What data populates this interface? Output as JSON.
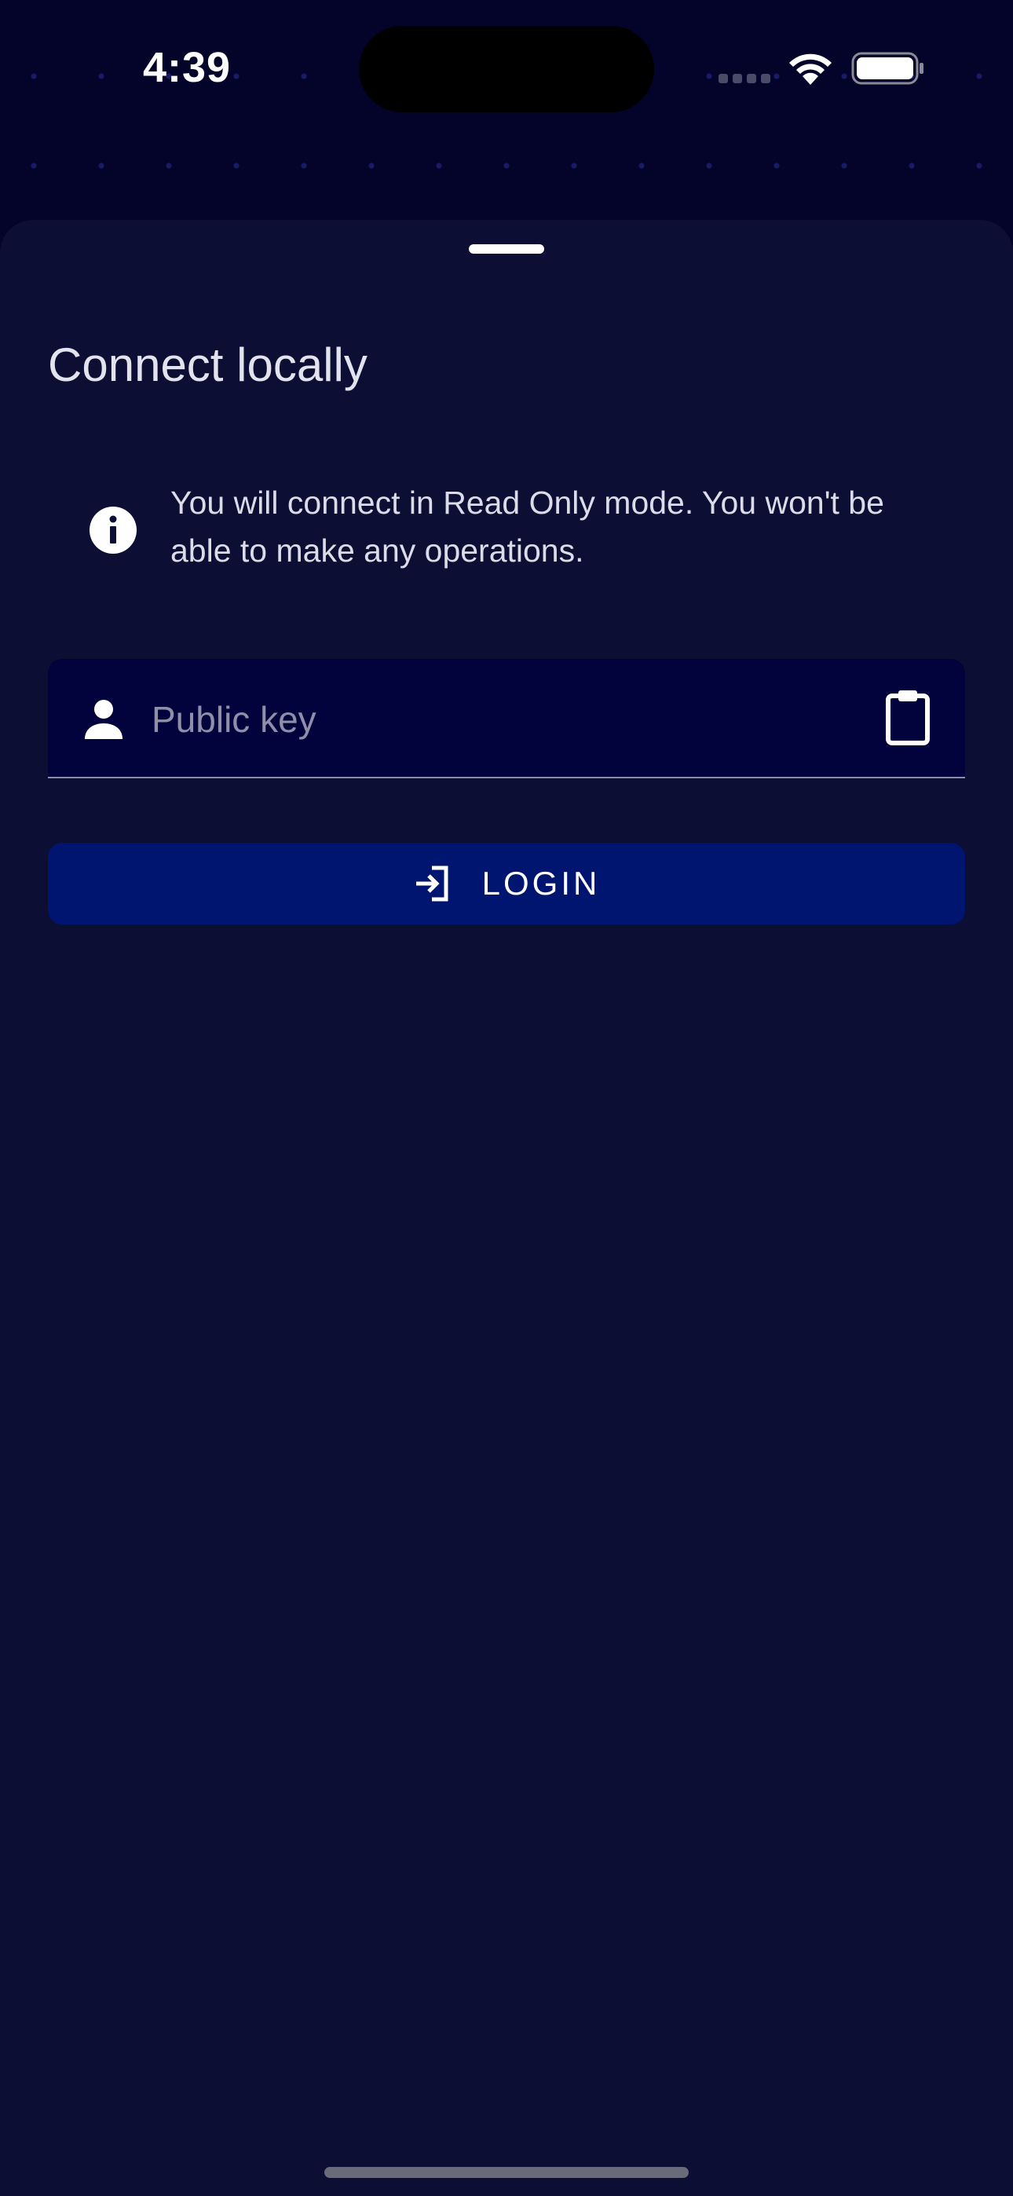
{
  "status_bar": {
    "time": "4:39"
  },
  "sheet": {
    "title": "Connect locally",
    "info_message": "You will connect in Read Only mode. You won't be able to make any operations.",
    "public_key_input": {
      "placeholder": "Public key",
      "value": ""
    },
    "login_button": {
      "label": "LOGIN"
    }
  },
  "icons": {
    "info": "info-icon",
    "person": "person-icon",
    "clipboard": "clipboard-icon",
    "login": "login-icon",
    "wifi": "wifi-icon",
    "battery": "battery-icon",
    "signal": "cellular-signal-icon"
  },
  "colors": {
    "background": "#04042a",
    "sheet": "#0d0e33",
    "input_background": "#02023c",
    "button": "#001570",
    "text_primary": "#e3e3ee",
    "placeholder": "#8f8fa9"
  }
}
